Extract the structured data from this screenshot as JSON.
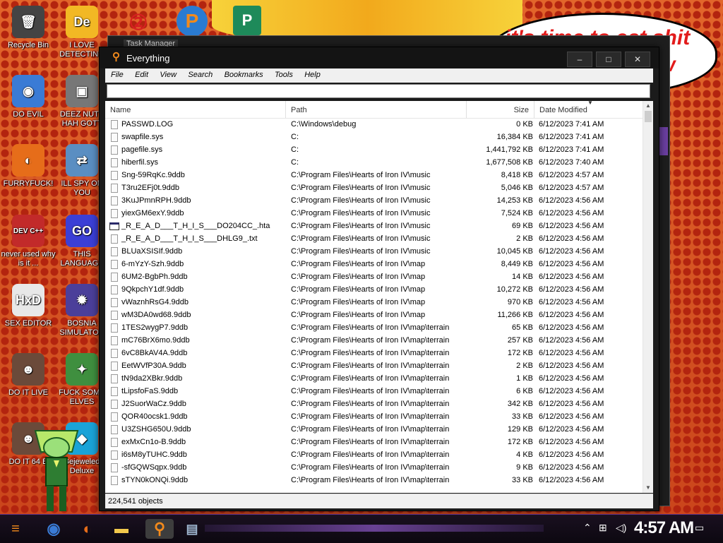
{
  "desktop": {
    "icons": [
      {
        "label": "Recycle Bin",
        "icon": "recycle-bin-icon",
        "color": "#444444",
        "glyph": "🗑"
      },
      {
        "label": "I LOVE DETECTING",
        "icon": "de-app-icon",
        "color": "#f2b824",
        "glyph": "De"
      },
      {
        "label": "DO EVIL",
        "icon": "chrome-icon",
        "color": "#3a7bd5",
        "glyph": "◉"
      },
      {
        "label": "DEEZ NUTS HAH GOTT",
        "icon": "windows-stack-icon",
        "color": "#777777",
        "glyph": "▣"
      },
      {
        "label": "FURRYFUCK!",
        "icon": "firefox-icon",
        "color": "#e66d1a",
        "glyph": "◐"
      },
      {
        "label": "ILL SPY ON YOU",
        "icon": "network-icon",
        "color": "#5a8ec2",
        "glyph": "⇄"
      },
      {
        "label": "never used why is it ...",
        "icon": "dev-cpp-icon",
        "color": "#c22a2a",
        "glyph": "DEV C++"
      },
      {
        "label": "THIS LANGUAGE",
        "icon": "golang-icon",
        "color": "#3b3fd6",
        "glyph": "GO"
      },
      {
        "label": "SEX EDITOR",
        "icon": "hxd-icon",
        "color": "#e8e8e8",
        "glyph": "HxD"
      },
      {
        "label": "BOSNIA SIMULATOR",
        "icon": "mine-icon",
        "color": "#4b3f9a",
        "glyph": "✹"
      },
      {
        "label": "DO IT LIVE",
        "icon": "portrait-icon",
        "color": "#6b4a3a",
        "glyph": "☻"
      },
      {
        "label": "FUCK SOME ELVES",
        "icon": "elves-icon",
        "color": "#3f8f3f",
        "glyph": "✦"
      },
      {
        "label": "DO IT 64 B",
        "icon": "portrait-icon-2",
        "color": "#6b4a3a",
        "glyph": "☻"
      },
      {
        "label": "Bejeweled Deluxe",
        "icon": "gem-icon",
        "color": "#1aa3d8",
        "glyph": "◆"
      }
    ],
    "speech_bubble": {
      "line1": "it's time to eat shit",
      "line2": "w"
    },
    "behind_window_title": "Task Manager"
  },
  "window": {
    "title": "Everything",
    "menu": [
      "File",
      "Edit",
      "View",
      "Search",
      "Bookmarks",
      "Tools",
      "Help"
    ],
    "search_value": "",
    "columns": {
      "name": "Name",
      "path": "Path",
      "size": "Size",
      "date": "Date Modified"
    },
    "rows": [
      {
        "name": "PASSWD.LOG",
        "path": "C:\\Windows\\debug",
        "size": "0 KB",
        "date": "6/12/2023 7:41 AM"
      },
      {
        "name": "swapfile.sys",
        "path": "C:",
        "size": "16,384 KB",
        "date": "6/12/2023 7:41 AM"
      },
      {
        "name": "pagefile.sys",
        "path": "C:",
        "size": "1,441,792 KB",
        "date": "6/12/2023 7:41 AM"
      },
      {
        "name": "hiberfil.sys",
        "path": "C:",
        "size": "1,677,508 KB",
        "date": "6/12/2023 7:40 AM"
      },
      {
        "name": "Sng-59RqKc.9ddb",
        "path": "C:\\Program Files\\Hearts of Iron IV\\music",
        "size": "8,418 KB",
        "date": "6/12/2023 4:57 AM"
      },
      {
        "name": "T3ru2EFj0t.9ddb",
        "path": "C:\\Program Files\\Hearts of Iron IV\\music",
        "size": "5,046 KB",
        "date": "6/12/2023 4:57 AM"
      },
      {
        "name": "3KuJPmnRPH.9ddb",
        "path": "C:\\Program Files\\Hearts of Iron IV\\music",
        "size": "14,253 KB",
        "date": "6/12/2023 4:56 AM"
      },
      {
        "name": "yiexGM6exY.9ddb",
        "path": "C:\\Program Files\\Hearts of Iron IV\\music",
        "size": "7,524 KB",
        "date": "6/12/2023 4:56 AM"
      },
      {
        "name": "_R_E_A_D___T_H_I_S___DO204CC_.hta",
        "path": "C:\\Program Files\\Hearts of Iron IV\\music",
        "size": "69 KB",
        "date": "6/12/2023 4:56 AM",
        "type": "hta"
      },
      {
        "name": "_R_E_A_D___T_H_I_S___DHLG9_.txt",
        "path": "C:\\Program Files\\Hearts of Iron IV\\music",
        "size": "2 KB",
        "date": "6/12/2023 4:56 AM"
      },
      {
        "name": "BLUaXSISIf.9ddb",
        "path": "C:\\Program Files\\Hearts of Iron IV\\music",
        "size": "10,045 KB",
        "date": "6/12/2023 4:56 AM"
      },
      {
        "name": "6-mYzY-Szh.9ddb",
        "path": "C:\\Program Files\\Hearts of Iron IV\\map",
        "size": "8,449 KB",
        "date": "6/12/2023 4:56 AM"
      },
      {
        "name": "6UM2-BgbPh.9ddb",
        "path": "C:\\Program Files\\Hearts of Iron IV\\map",
        "size": "14 KB",
        "date": "6/12/2023 4:56 AM"
      },
      {
        "name": "9QkpchY1df.9ddb",
        "path": "C:\\Program Files\\Hearts of Iron IV\\map",
        "size": "10,272 KB",
        "date": "6/12/2023 4:56 AM"
      },
      {
        "name": "vWaznhRsG4.9ddb",
        "path": "C:\\Program Files\\Hearts of Iron IV\\map",
        "size": "970 KB",
        "date": "6/12/2023 4:56 AM"
      },
      {
        "name": "wM3DA0wd68.9ddb",
        "path": "C:\\Program Files\\Hearts of Iron IV\\map",
        "size": "11,266 KB",
        "date": "6/12/2023 4:56 AM"
      },
      {
        "name": "1TES2wygP7.9ddb",
        "path": "C:\\Program Files\\Hearts of Iron IV\\map\\terrain",
        "size": "65 KB",
        "date": "6/12/2023 4:56 AM"
      },
      {
        "name": "mC76BrX6mo.9ddb",
        "path": "C:\\Program Files\\Hearts of Iron IV\\map\\terrain",
        "size": "257 KB",
        "date": "6/12/2023 4:56 AM"
      },
      {
        "name": "6vC8BkAV4A.9ddb",
        "path": "C:\\Program Files\\Hearts of Iron IV\\map\\terrain",
        "size": "172 KB",
        "date": "6/12/2023 4:56 AM"
      },
      {
        "name": "EetWVfP30A.9ddb",
        "path": "C:\\Program Files\\Hearts of Iron IV\\map\\terrain",
        "size": "2 KB",
        "date": "6/12/2023 4:56 AM"
      },
      {
        "name": "tN9da2XBkr.9ddb",
        "path": "C:\\Program Files\\Hearts of Iron IV\\map\\terrain",
        "size": "1 KB",
        "date": "6/12/2023 4:56 AM"
      },
      {
        "name": "tLipsfoFaS.9ddb",
        "path": "C:\\Program Files\\Hearts of Iron IV\\map\\terrain",
        "size": "6 KB",
        "date": "6/12/2023 4:56 AM"
      },
      {
        "name": "J2SuorWaCz.9ddb",
        "path": "C:\\Program Files\\Hearts of Iron IV\\map\\terrain",
        "size": "342 KB",
        "date": "6/12/2023 4:56 AM"
      },
      {
        "name": "QOR40ocsk1.9ddb",
        "path": "C:\\Program Files\\Hearts of Iron IV\\map\\terrain",
        "size": "33 KB",
        "date": "6/12/2023 4:56 AM"
      },
      {
        "name": "U3ZSHG650U.9ddb",
        "path": "C:\\Program Files\\Hearts of Iron IV\\map\\terrain",
        "size": "129 KB",
        "date": "6/12/2023 4:56 AM"
      },
      {
        "name": "exMxCn1o-B.9ddb",
        "path": "C:\\Program Files\\Hearts of Iron IV\\map\\terrain",
        "size": "172 KB",
        "date": "6/12/2023 4:56 AM"
      },
      {
        "name": "i6sM8yTUHC.9ddb",
        "path": "C:\\Program Files\\Hearts of Iron IV\\map\\terrain",
        "size": "4 KB",
        "date": "6/12/2023 4:56 AM"
      },
      {
        "name": "-sfGQWSqpx.9ddb",
        "path": "C:\\Program Files\\Hearts of Iron IV\\map\\terrain",
        "size": "9 KB",
        "date": "6/12/2023 4:56 AM"
      },
      {
        "name": "sTYN0kONQi.9ddb",
        "path": "C:\\Program Files\\Hearts of Iron IV\\map\\terrain",
        "size": "33 KB",
        "date": "6/12/2023 4:56 AM"
      }
    ],
    "status": "224,541 objects"
  },
  "taskbar": {
    "clock": "4:57 AM",
    "accent": "#8d58c8"
  }
}
